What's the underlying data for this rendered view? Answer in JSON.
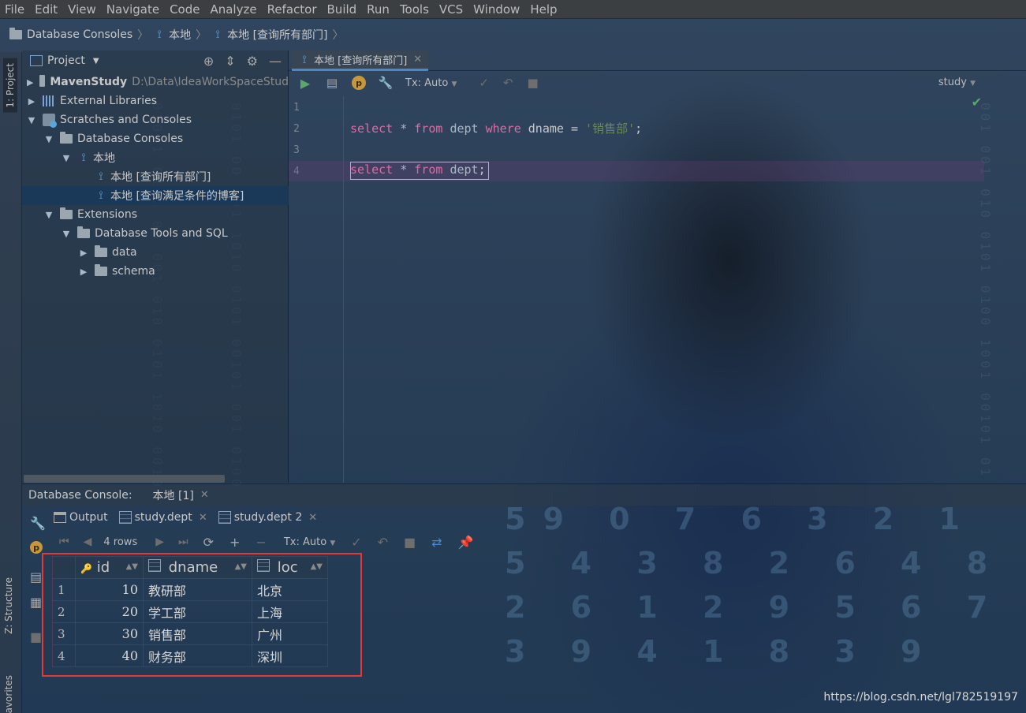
{
  "menu": [
    "File",
    "Edit",
    "View",
    "Navigate",
    "Code",
    "Analyze",
    "Refactor",
    "Build",
    "Run",
    "Tools",
    "VCS",
    "Window",
    "Help"
  ],
  "breadcrumb": {
    "root": "Database Consoles",
    "items": [
      "本地",
      "本地 [查询所有部门]"
    ]
  },
  "left_strip": {
    "project_tab": "1: Project",
    "structure_tab": "Z: Structure",
    "favorites_tab": "avorites"
  },
  "project": {
    "title": "Project",
    "tree": [
      {
        "label": "MavenStudy",
        "path": "D:\\Data\\IdeaWorkSpaceStud"
      },
      {
        "label": "External Libraries"
      },
      {
        "label": "Scratches and Consoles"
      },
      {
        "label": "Database Consoles"
      },
      {
        "label": "本地"
      },
      {
        "label": "本地 [查询所有部门]"
      },
      {
        "label": "本地 [查询满足条件的博客]"
      },
      {
        "label": "Extensions"
      },
      {
        "label": "Database Tools and SQL"
      },
      {
        "label": "data"
      },
      {
        "label": "schema"
      }
    ]
  },
  "editor": {
    "tab": "本地 [查询所有部门]",
    "tx_mode": "Tx: Auto",
    "schema": "study",
    "line_numbers": [
      "1",
      "2",
      "3",
      "4"
    ],
    "line2": {
      "select": "select",
      "star": "*",
      "from": "from",
      "table": "dept",
      "where": "where",
      "col": "dname",
      "eq": "=",
      "q1": "'",
      "value": "销售部",
      "q2": "'",
      "semi": ";"
    },
    "line4": {
      "select": "select",
      "star": "*",
      "from": "from",
      "table": "dept",
      "semi": ";"
    }
  },
  "bottom": {
    "title": "Database Console:",
    "session_tab": "本地 [1]",
    "tabs": [
      "Output",
      "study.dept",
      "study.dept 2"
    ],
    "rows_label": "4 rows",
    "tx_mode": "Tx: Auto",
    "columns": [
      "id",
      "dname",
      "loc"
    ],
    "rows": [
      {
        "n": "1",
        "id": "10",
        "dname": "教研部",
        "loc": "北京"
      },
      {
        "n": "2",
        "id": "20",
        "dname": "学工部",
        "loc": "上海"
      },
      {
        "n": "3",
        "id": "30",
        "dname": "销售部",
        "loc": "广州"
      },
      {
        "n": "4",
        "id": "40",
        "dname": "财务部",
        "loc": "深圳"
      }
    ]
  },
  "watermark": "https://blog.csdn.net/lgl782519197",
  "colors": {
    "accent": "#4a88c7",
    "keyword": "#cc7832",
    "string": "#6a8759",
    "highlight_box": "#e53935"
  }
}
